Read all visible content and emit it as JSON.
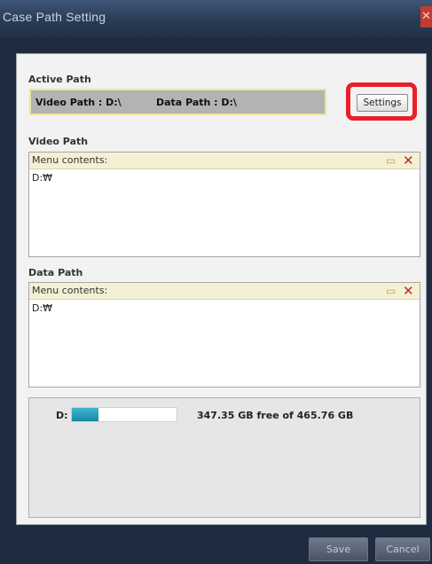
{
  "window": {
    "title": "Case Path Setting",
    "close_label": "X"
  },
  "active_path": {
    "heading": "Active Path",
    "video_path_text": "Video Path : D:\\",
    "data_path_text": "Data Path : D:\\",
    "settings_label": "Settings"
  },
  "video_path": {
    "heading": "Video Path",
    "header_label": "Menu contents:",
    "items": [
      "D:₩"
    ]
  },
  "data_path": {
    "heading": "Data Path",
    "header_label": "Menu contents:",
    "items": [
      "D:₩"
    ]
  },
  "disk": {
    "drive": "D:",
    "used_fraction": 0.254,
    "free_text": "347.35 GB free of 465.76 GB"
  },
  "footer": {
    "save_label": "Save",
    "cancel_label": "Cancel"
  },
  "icons": {
    "new_item": "new-item-icon",
    "delete": "delete-icon",
    "close": "close-icon"
  },
  "colors": {
    "highlight": "#e8202a",
    "progress": "#1587a3"
  }
}
